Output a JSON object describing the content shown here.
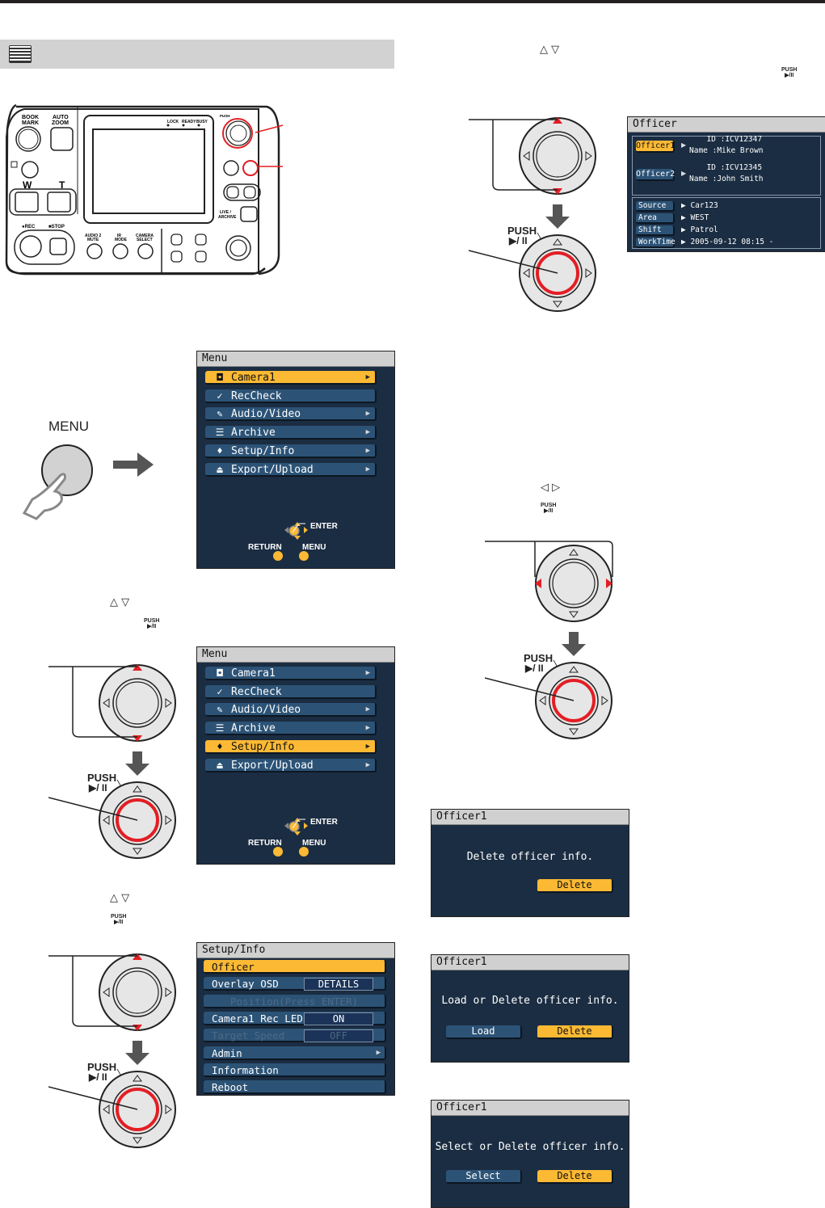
{
  "section_header": {
    "icon": "menu-screen-icon"
  },
  "panel": {
    "labels": {
      "bookmark": "BOOK\nMARK",
      "auto_zoom": "AUTO\nZOOM",
      "w": "W",
      "t": "T",
      "rec": "●REC",
      "stop": "■STOP",
      "audio2_mute": "AUDIO 2\nMUTE",
      "ir_mode": "IR\nMODE",
      "camera_select": "CAMERA\nSELECT",
      "live_archive": "LIVE /\nARCHIVE",
      "lock": "LOCK",
      "ready": "READY",
      "busy": "BUSY",
      "push": "PUSH\n▶/ II"
    }
  },
  "menu_button": {
    "label": "MENU"
  },
  "menu_screen_1": {
    "title": "Menu",
    "items": [
      {
        "label": "Camera1",
        "icon": "camera-icon",
        "glyph": "◘",
        "arrow": true,
        "selected": true
      },
      {
        "label": "RecCheck",
        "icon": "reccheck-icon",
        "glyph": "✓",
        "arrow": false,
        "selected": false
      },
      {
        "label": "Audio/Video",
        "icon": "microphone-icon",
        "glyph": "✎",
        "arrow": true,
        "selected": false
      },
      {
        "label": "Archive",
        "icon": "archive-icon",
        "glyph": "☰",
        "arrow": true,
        "selected": false
      },
      {
        "label": "Setup/Info",
        "icon": "setup-icon",
        "glyph": "♦",
        "arrow": true,
        "selected": false
      },
      {
        "label": "Export/Upload",
        "icon": "upload-icon",
        "glyph": "⏏",
        "arrow": true,
        "selected": false
      }
    ],
    "legend": {
      "enter": "ENTER",
      "return": "RETURN",
      "menu": "MENU"
    }
  },
  "menu_screen_2": {
    "title": "Menu",
    "items": [
      {
        "label": "Camera1",
        "icon": "camera-icon",
        "glyph": "◘",
        "arrow": true,
        "selected": false
      },
      {
        "label": "RecCheck",
        "icon": "reccheck-icon",
        "glyph": "✓",
        "arrow": false,
        "selected": false
      },
      {
        "label": "Audio/Video",
        "icon": "microphone-icon",
        "glyph": "✎",
        "arrow": true,
        "selected": false
      },
      {
        "label": "Archive",
        "icon": "archive-icon",
        "glyph": "☰",
        "arrow": true,
        "selected": false
      },
      {
        "label": "Setup/Info",
        "icon": "setup-icon",
        "glyph": "♦",
        "arrow": true,
        "selected": true
      },
      {
        "label": "Export/Upload",
        "icon": "upload-icon",
        "glyph": "⏏",
        "arrow": true,
        "selected": false
      }
    ],
    "legend": {
      "enter": "ENTER",
      "return": "RETURN",
      "menu": "MENU"
    }
  },
  "setup_screen": {
    "title": "Setup/Info",
    "items": [
      {
        "label": "Officer",
        "value": null,
        "arrow": false,
        "selected": true,
        "disabled": false
      },
      {
        "label": "Overlay OSD",
        "value": "DETAILS",
        "arrow": false,
        "selected": false,
        "disabled": false
      },
      {
        "label": "Position(Press ENTER)",
        "value": null,
        "arrow": false,
        "selected": false,
        "disabled": true,
        "centered": true
      },
      {
        "label": "Camera1 Rec LED",
        "value": "ON",
        "arrow": false,
        "selected": false,
        "disabled": false
      },
      {
        "label": "Target Speed",
        "value": "OFF",
        "arrow": false,
        "selected": false,
        "disabled": true
      },
      {
        "label": "Admin",
        "value": null,
        "arrow": true,
        "selected": false,
        "disabled": false
      },
      {
        "label": "Information",
        "value": null,
        "arrow": false,
        "selected": false,
        "disabled": false
      },
      {
        "label": "Reboot",
        "value": null,
        "arrow": false,
        "selected": false,
        "disabled": false
      }
    ]
  },
  "instructions": {
    "step_updown_1": {
      "keys": "△   ▽",
      "push": "PUSH\n▶/II"
    },
    "step_updown_2": {
      "keys": "△   ▽",
      "push": "PUSH\n▶/II"
    },
    "step_updown_3": {
      "keys": "△   ▽",
      "push": "PUSH\n▶/II"
    },
    "step_leftright": {
      "keys": "◁   ▷",
      "push": "PUSH\n▶/II"
    }
  },
  "joystick": {
    "push_label": "PUSH",
    "play_pause": "▶/ II"
  },
  "officer_screen": {
    "title": "Officer",
    "officers": [
      {
        "button": "Officer1",
        "selected": true,
        "id_label": "ID",
        "id": "ICV12347",
        "name_label": "Name",
        "name": "Mike Brown"
      },
      {
        "button": "Officer2",
        "selected": false,
        "id_label": "ID",
        "id": "ICV12345",
        "name_label": "Name",
        "name": "John Smith"
      }
    ],
    "fields": [
      {
        "label": "Source",
        "value": "Car123"
      },
      {
        "label": "Area",
        "value": "WEST"
      },
      {
        "label": "Shift",
        "value": "Patrol"
      },
      {
        "label": "WorkTime",
        "value": "2005-09-12 08:15 -"
      }
    ]
  },
  "dialog_delete": {
    "title": "Officer1",
    "message": "Delete officer info.",
    "buttons": [
      {
        "label": "Delete",
        "selected": true
      }
    ]
  },
  "dialog_load": {
    "title": "Officer1",
    "message": "Load or Delete officer info.",
    "buttons": [
      {
        "label": "Load",
        "selected": false
      },
      {
        "label": "Delete",
        "selected": true
      }
    ]
  },
  "dialog_select": {
    "title": "Officer1",
    "message": "Select or Delete officer info.",
    "buttons": [
      {
        "label": "Select",
        "selected": false
      },
      {
        "label": "Delete",
        "selected": true
      }
    ]
  },
  "colors": {
    "accent_yellow": "#fbb934",
    "osd_bg": "#1b2d42",
    "item_blue": "#2c5376",
    "highlight_red": "#e31e24"
  }
}
